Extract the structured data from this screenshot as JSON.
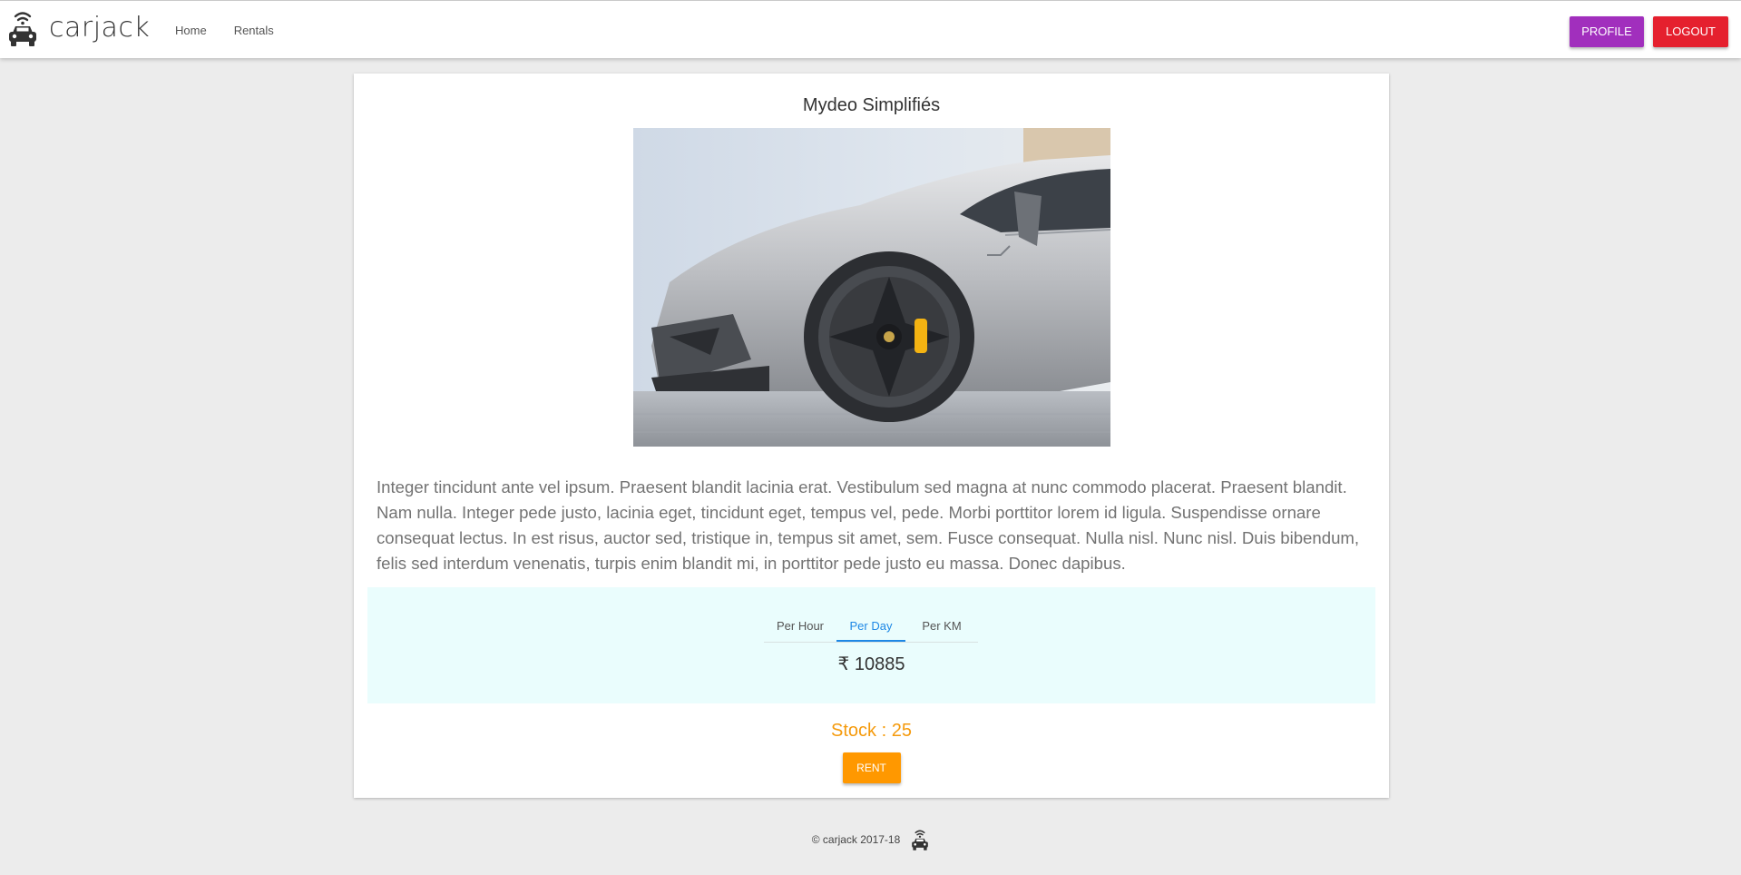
{
  "header": {
    "brand_name": "carjack",
    "brand_icon": "car-wifi-icon",
    "nav": [
      {
        "label": "Home"
      },
      {
        "label": "Rentals"
      }
    ],
    "profile_label": "PROFILE",
    "logout_label": "LOGOUT"
  },
  "car": {
    "title": "Mydeo Simplifiés",
    "image_subject": "silver-sports-car-photo",
    "description": "Integer tincidunt ante vel ipsum. Praesent blandit lacinia erat. Vestibulum sed magna at nunc commodo placerat. Praesent blandit. Nam nulla. Integer pede justo, lacinia eget, tincidunt eget, tempus vel, pede. Morbi porttitor lorem id ligula. Suspendisse ornare consequat lectus. In est risus, auctor sed, tristique in, tempus sit amet, sem. Fusce consequat. Nulla nisl. Nunc nisl. Duis bibendum, felis sed interdum venenatis, turpis enim blandit mi, in porttitor pede justo eu massa. Donec dapibus.",
    "pricing": {
      "tabs": [
        {
          "label": "Per Hour"
        },
        {
          "label": "Per Day",
          "active": true
        },
        {
          "label": "Per KM"
        }
      ],
      "price": "₹ 10885"
    },
    "stock": "Stock : 25",
    "rent_label": "RENT"
  },
  "footer": {
    "text": "© carjack 2017-18",
    "icon": "car-wifi-icon"
  },
  "colors": {
    "profile_button": "#a12fbd",
    "logout_button": "#e5202e",
    "rent_button": "#ff9800",
    "stock_text": "#f59a0c",
    "active_tab": "#1e88e5",
    "pricing_background": "#eafdfd"
  }
}
